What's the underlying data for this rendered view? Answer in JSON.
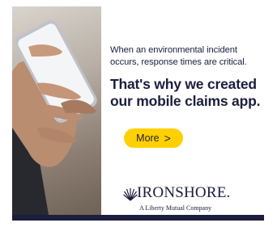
{
  "ad": {
    "lead_text": "When an environmental incident occurs, response times are critical.",
    "headline": "That's why we created our mobile claims app.",
    "cta_label": "More",
    "cta_icon": "chevron-right-icon",
    "brand_name": "IRONSHORE.",
    "brand_tagline": "A Liberty Mutual Company",
    "colors": {
      "navy": "#1b1e3d",
      "cta_yellow": "#ffd000"
    }
  }
}
